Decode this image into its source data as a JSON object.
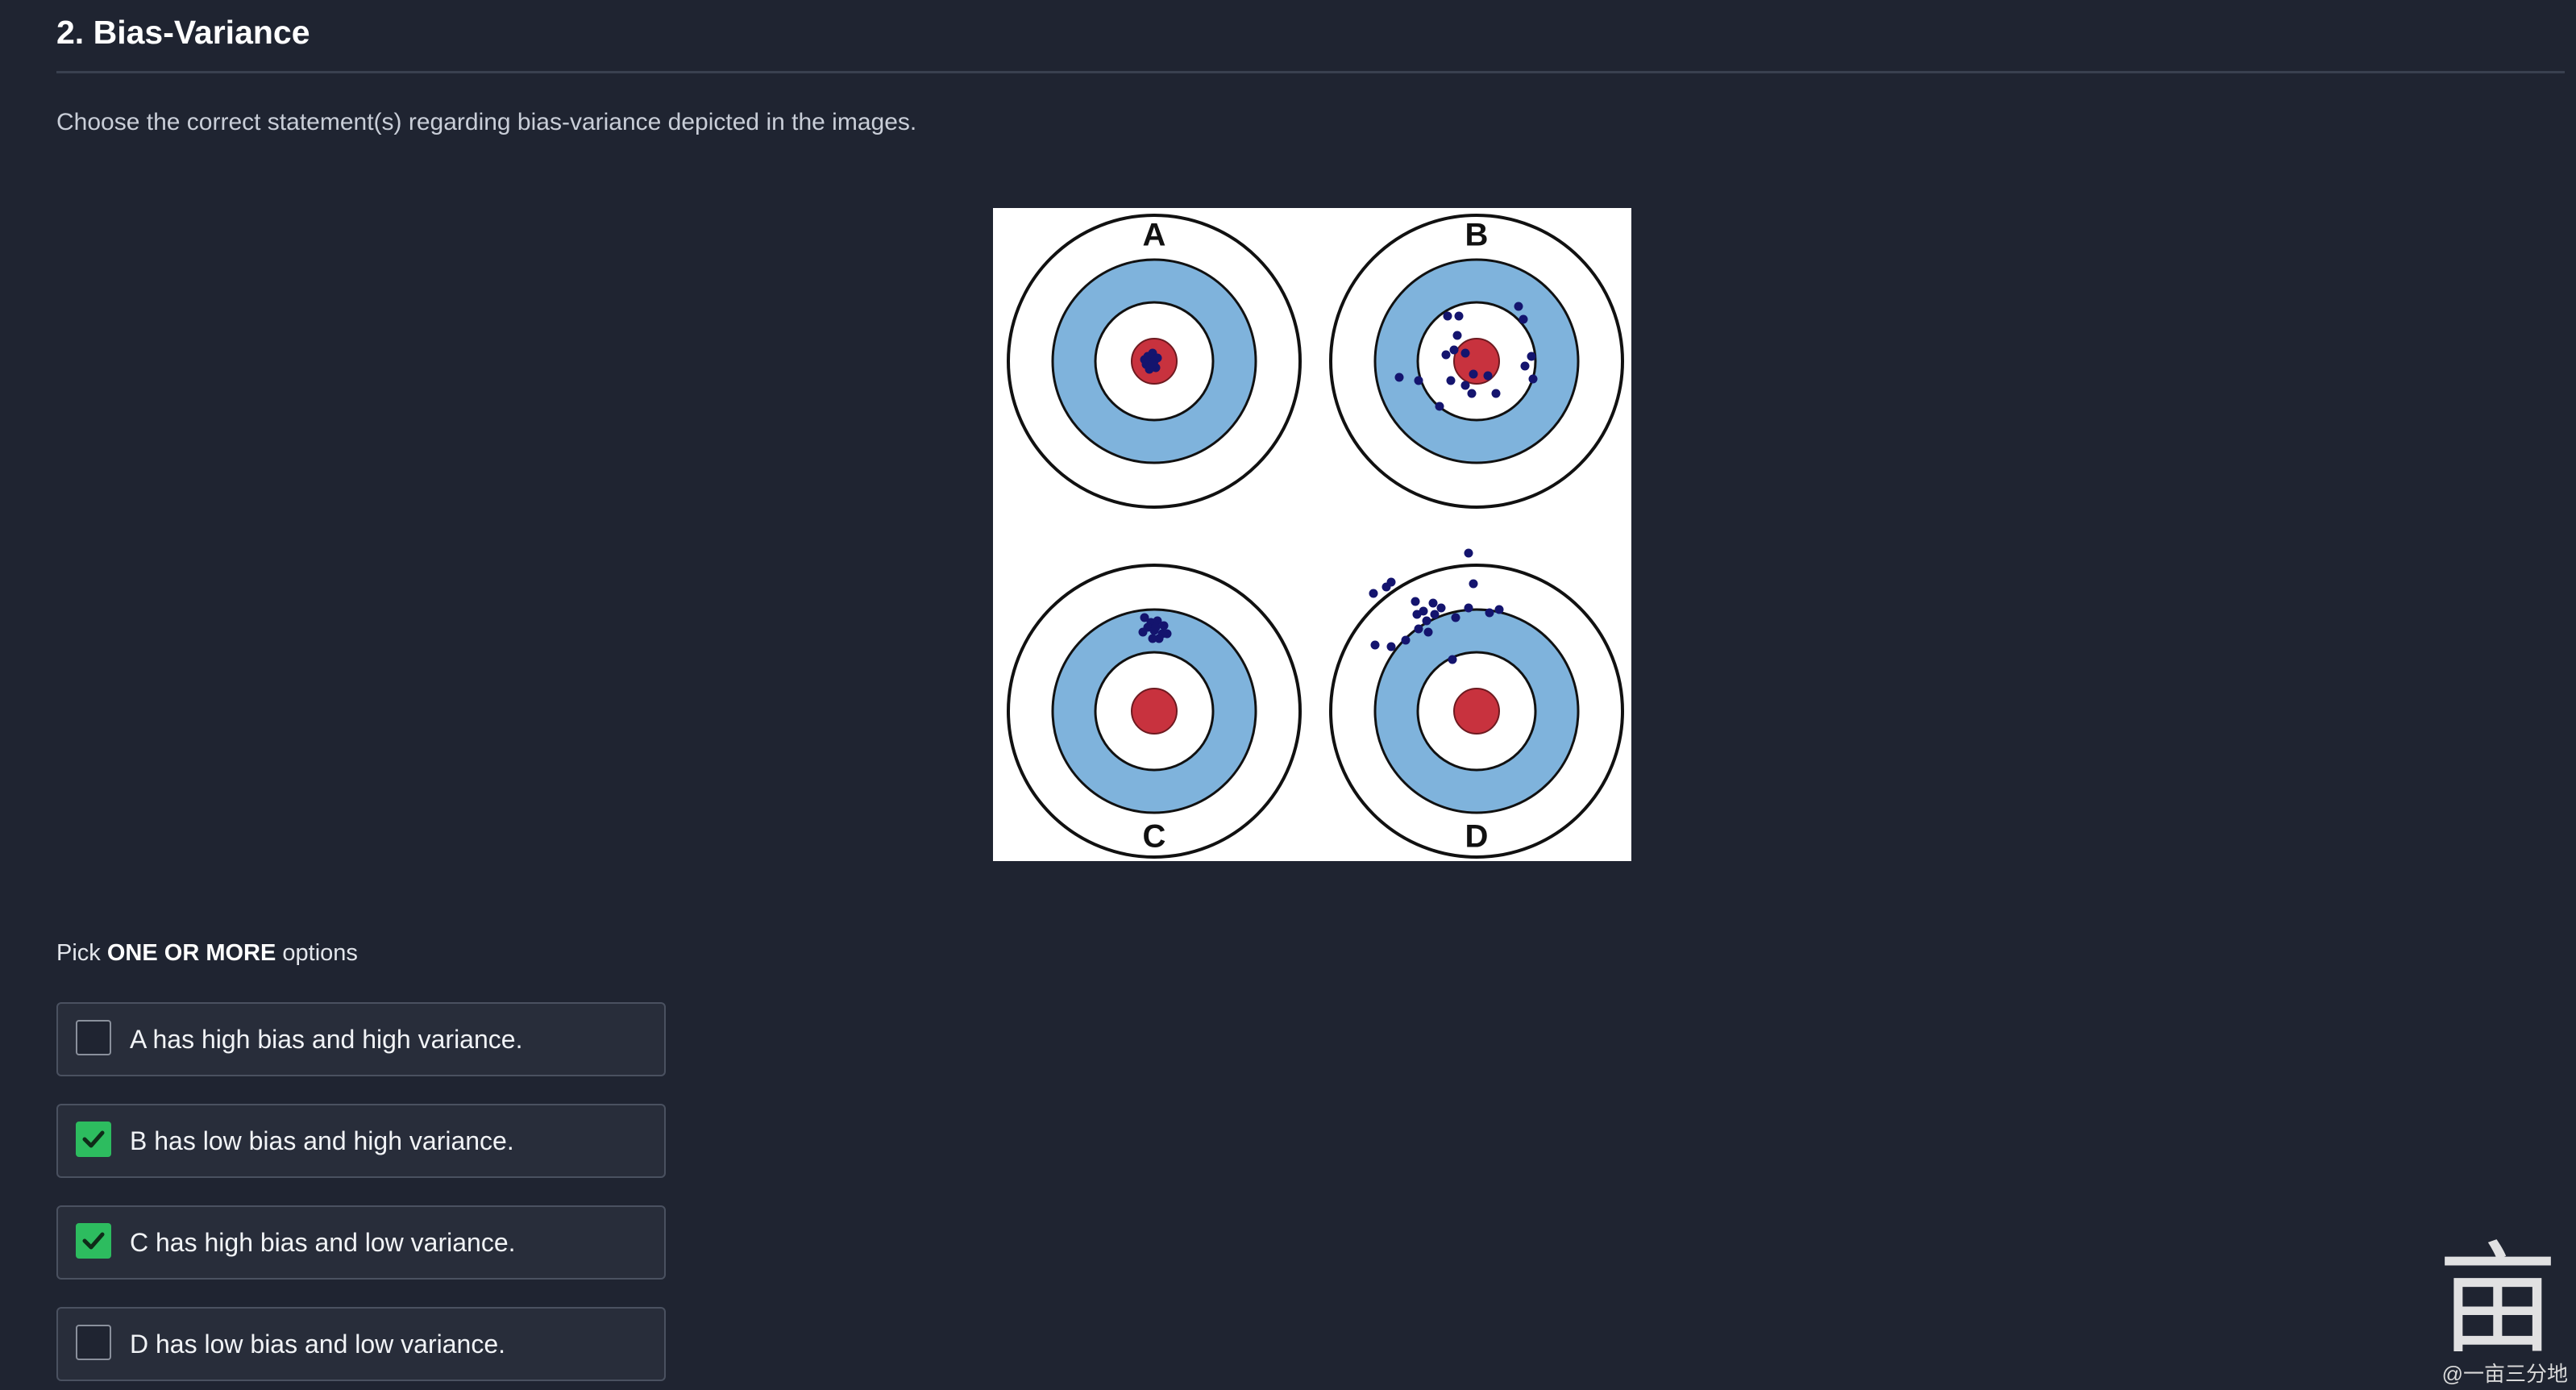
{
  "question": {
    "title": "2. Bias-Variance",
    "text": "Choose the correct statement(s) regarding bias-variance depicted in the images."
  },
  "figure": {
    "labels": [
      "A",
      "B",
      "C",
      "D"
    ],
    "colors": {
      "background": "#ffffff",
      "ring_outline": "#111111",
      "blue_ring": "#7fb3dc",
      "bullseye": "#c8323e",
      "dots": "#14146e"
    }
  },
  "pick": {
    "prefix": "Pick",
    "emphasis": "ONE OR MORE",
    "suffix": "options"
  },
  "options": [
    {
      "label": "A has high bias and high variance.",
      "checked": false
    },
    {
      "label": "B has low bias and high variance.",
      "checked": true
    },
    {
      "label": "C has high bias and low variance.",
      "checked": true
    },
    {
      "label": "D has low bias and low variance.",
      "checked": false
    }
  ],
  "watermark": {
    "glyph": "亩",
    "text": "@一亩三分地"
  },
  "colors": {
    "page_background": "#1f2431",
    "option_background": "#282d3a",
    "checked_green": "#2dbc5f"
  }
}
